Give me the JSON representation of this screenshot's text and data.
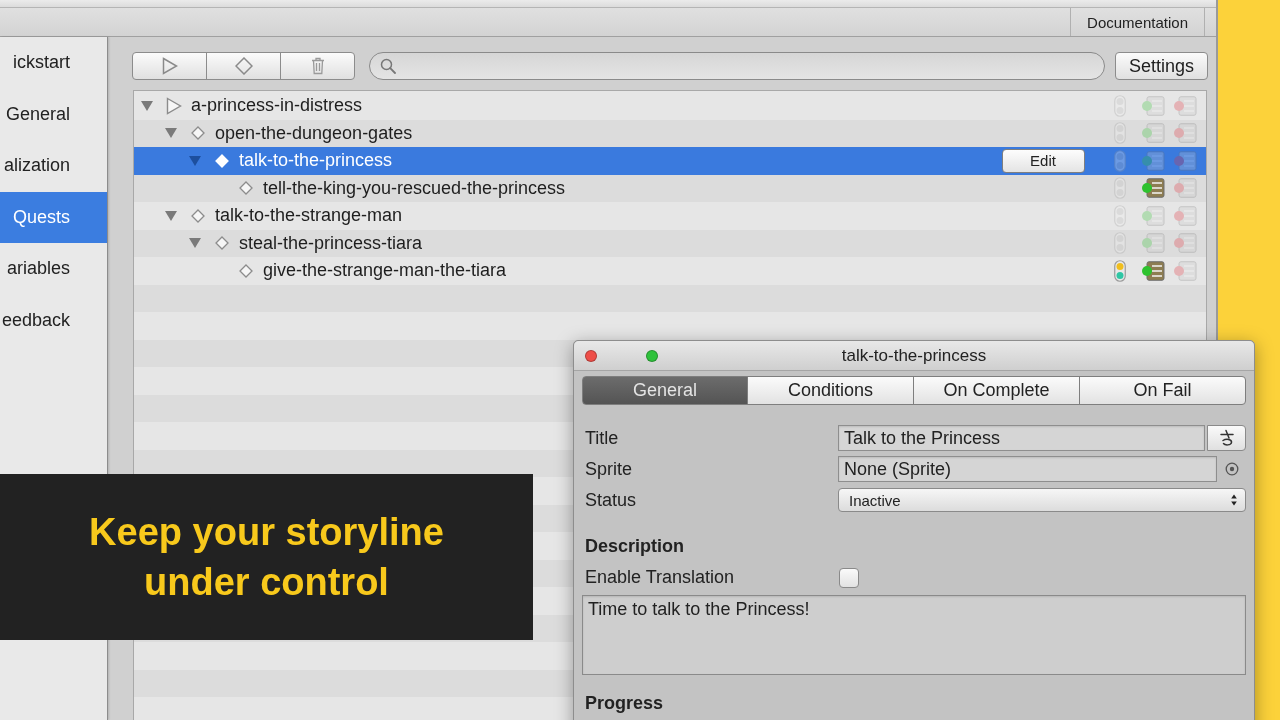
{
  "top_bar": {
    "documentation_button": "Documentation"
  },
  "sidebar": {
    "items": [
      {
        "label": "ickstart",
        "selected": false
      },
      {
        "label": "General",
        "selected": false
      },
      {
        "label": "alization",
        "selected": false
      },
      {
        "label": "Quests",
        "selected": true
      },
      {
        "label": "ariables",
        "selected": false
      },
      {
        "label": "eedback",
        "selected": false
      }
    ]
  },
  "toolbar": {
    "buttons": [
      {
        "kind": "play"
      },
      {
        "kind": "diamond"
      },
      {
        "kind": "trash"
      }
    ],
    "settings_button": "Settings"
  },
  "tree": {
    "edit_button": "Edit",
    "nodes": [
      {
        "label": "a-princess-in-distress",
        "kind": "quest",
        "expanded": true,
        "selected": false,
        "markers": [
          {
            "kind": "status",
            "on": false
          },
          {
            "kind": "complete",
            "on": false
          },
          {
            "kind": "fail",
            "on": false
          }
        ],
        "children": [
          {
            "label": "open-the-dungeon-gates",
            "kind": "task",
            "expanded": true,
            "selected": false,
            "markers": [
              {
                "kind": "status",
                "on": false
              },
              {
                "kind": "complete",
                "on": false
              },
              {
                "kind": "fail",
                "on": false
              }
            ],
            "children": [
              {
                "label": "talk-to-the-princess",
                "kind": "task",
                "expanded": true,
                "selected": true,
                "markers": [
                  {
                    "kind": "status",
                    "on": false
                  },
                  {
                    "kind": "complete",
                    "on": false
                  },
                  {
                    "kind": "fail",
                    "on": false
                  }
                ],
                "children": [
                  {
                    "label": "tell-the-king-you-rescued-the-princess",
                    "kind": "task",
                    "selected": false,
                    "markers": [
                      {
                        "kind": "status",
                        "on": false
                      },
                      {
                        "kind": "complete",
                        "on": true
                      },
                      {
                        "kind": "fail",
                        "on": false
                      }
                    ]
                  }
                ]
              }
            ]
          },
          {
            "label": "talk-to-the-strange-man",
            "kind": "task",
            "expanded": true,
            "selected": false,
            "markers": [
              {
                "kind": "status",
                "on": false
              },
              {
                "kind": "complete",
                "on": false
              },
              {
                "kind": "fail",
                "on": false
              }
            ],
            "children": [
              {
                "label": "steal-the-princess-tiara",
                "kind": "task",
                "expanded": true,
                "selected": false,
                "markers": [
                  {
                    "kind": "status",
                    "on": false
                  },
                  {
                    "kind": "complete",
                    "on": false
                  },
                  {
                    "kind": "fail",
                    "on": false
                  }
                ],
                "children": [
                  {
                    "label": "give-the-strange-man-the-tiara",
                    "kind": "task",
                    "selected": false,
                    "markers": [
                      {
                        "kind": "status",
                        "on": true
                      },
                      {
                        "kind": "complete",
                        "on": true
                      },
                      {
                        "kind": "fail",
                        "on": false
                      }
                    ]
                  }
                ]
              }
            ]
          }
        ]
      }
    ]
  },
  "caption": {
    "text": "Keep your storyline under control"
  },
  "inspector": {
    "title": "talk-to-the-princess",
    "tabs": [
      {
        "label": "General",
        "selected": true
      },
      {
        "label": "Conditions",
        "selected": false
      },
      {
        "label": "On Complete",
        "selected": false
      },
      {
        "label": "On Fail",
        "selected": false
      }
    ],
    "fields": [
      {
        "kind": "text",
        "label": "Title",
        "value": "Talk to the Princess"
      },
      {
        "kind": "object",
        "label": "Sprite",
        "value": "None (Sprite)"
      },
      {
        "kind": "select",
        "label": "Status",
        "value": "Inactive"
      }
    ],
    "description": {
      "heading": "Description",
      "translation_label": "Enable Translation",
      "translation_checked": false,
      "text": "Time to talk to the Princess!"
    },
    "progress": {
      "heading": "Progress"
    }
  }
}
